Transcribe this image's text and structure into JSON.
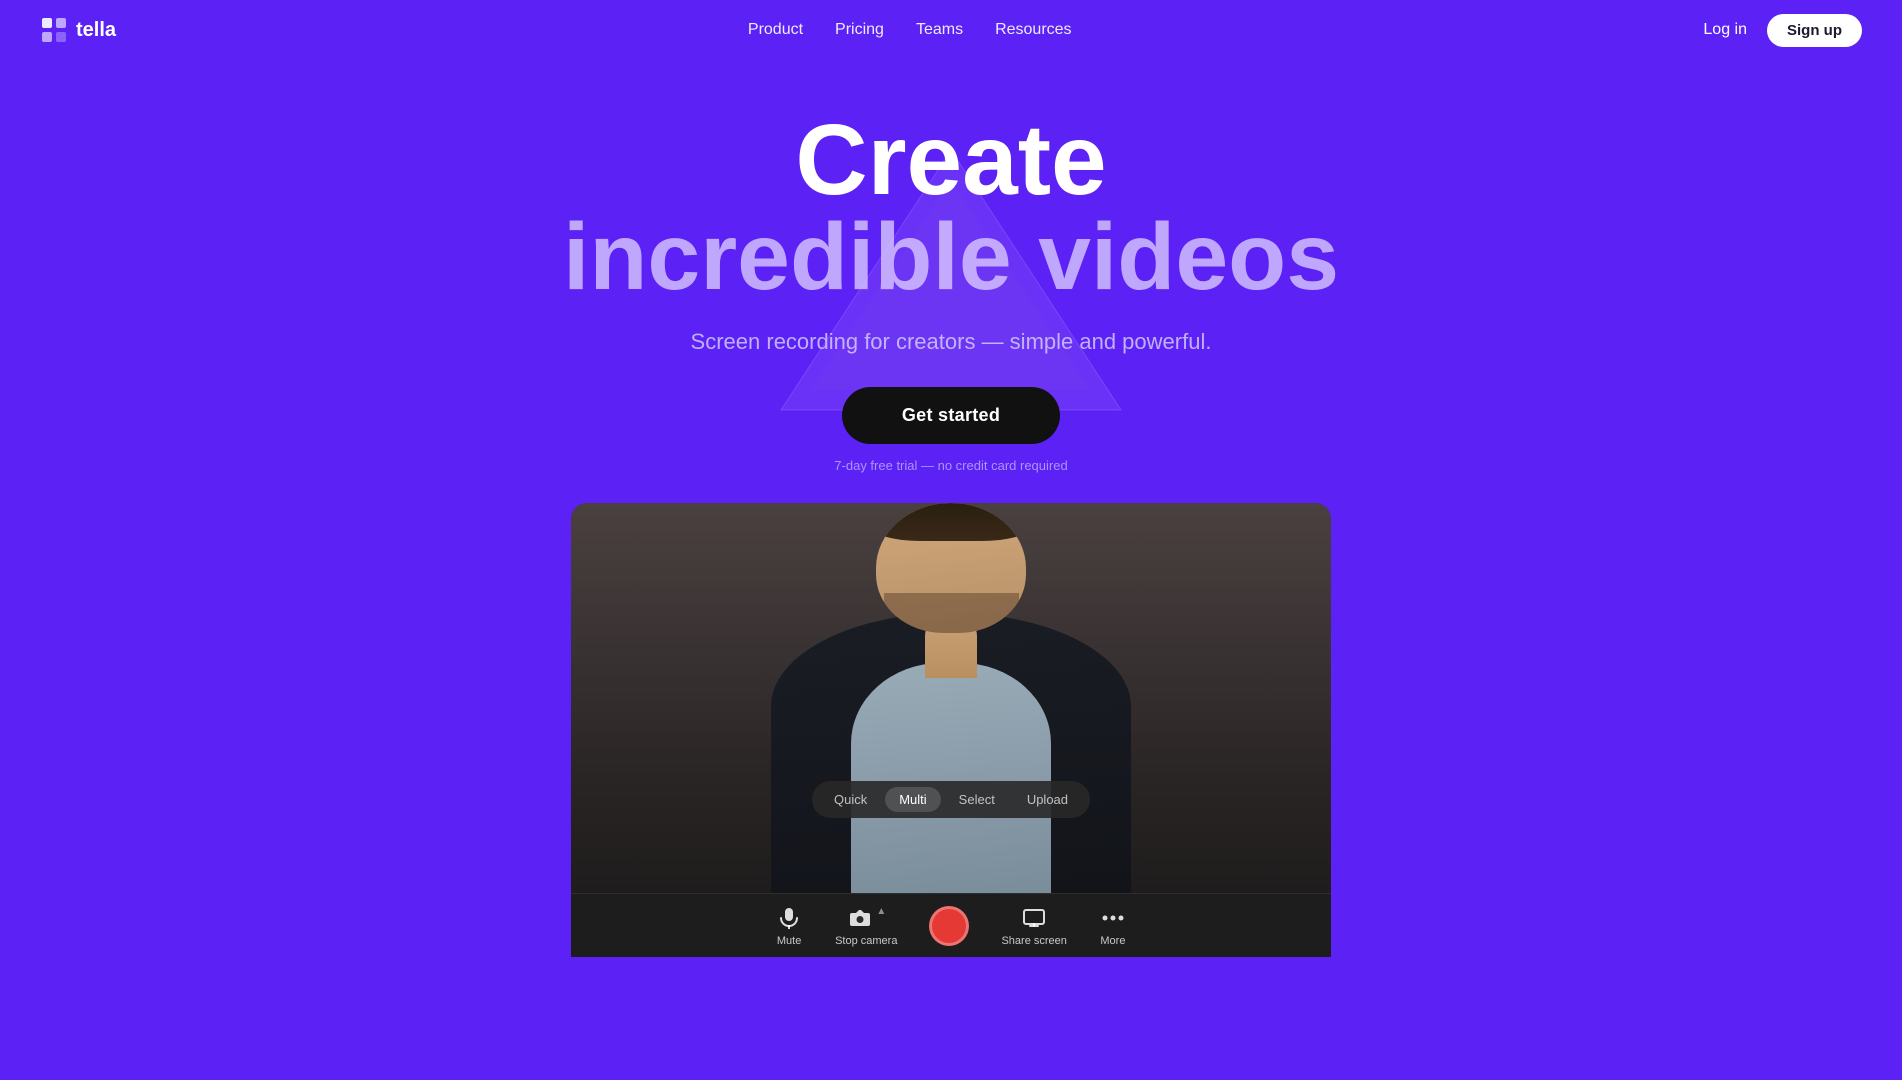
{
  "brand": {
    "name": "tella",
    "logo_alt": "Tella logo"
  },
  "nav": {
    "links": [
      {
        "label": "Product",
        "href": "#"
      },
      {
        "label": "Pricing",
        "href": "#"
      },
      {
        "label": "Teams",
        "href": "#"
      },
      {
        "label": "Resources",
        "href": "#"
      }
    ],
    "login_label": "Log in",
    "signup_label": "Sign up"
  },
  "hero": {
    "headline_line1": "Create",
    "headline_line2": "incredible videos",
    "subtitle": "Screen recording for creators — simple and powerful.",
    "cta_label": "Get started",
    "note": "7-day free trial — no credit card required"
  },
  "video_ui": {
    "camera_tabs": [
      {
        "label": "Quick",
        "active": false
      },
      {
        "label": "Multi",
        "active": true
      },
      {
        "label": "Select",
        "active": false
      },
      {
        "label": "Upload",
        "active": false
      }
    ],
    "toolbar_items": [
      {
        "label": "Mute",
        "icon": "mic"
      },
      {
        "label": "Stop camera",
        "icon": "camera"
      },
      {
        "label": "record",
        "type": "record"
      },
      {
        "label": "Share screen",
        "icon": "screen"
      },
      {
        "label": "More",
        "icon": "more"
      }
    ]
  }
}
